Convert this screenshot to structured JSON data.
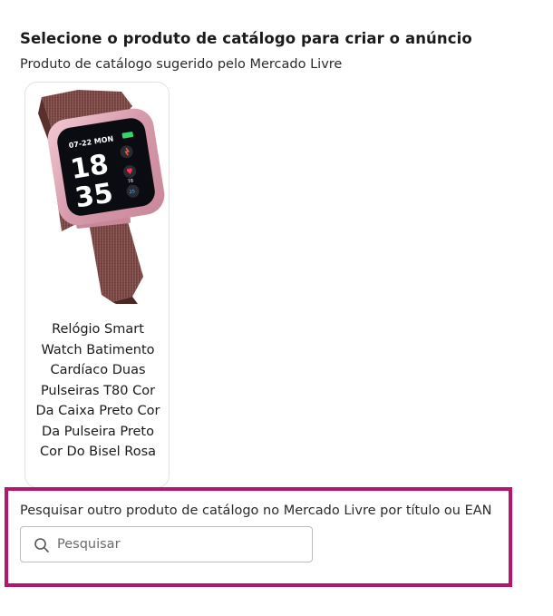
{
  "header": {
    "title": "Selecione o produto de catálogo para criar o anúncio",
    "subtitle": "Produto de catálogo sugerido pelo Mercado Livre"
  },
  "suggested_product": {
    "title": "Relógio Smart Watch Batimento Cardíaco Duas Pulseiras T80 Cor Da Caixa Preto Cor Da Pulseira Preto Cor Do Bisel Rosa",
    "image": {
      "date": "07-22 MON",
      "hour": "18",
      "minute": "35",
      "stats": [
        "78",
        "25"
      ]
    }
  },
  "search": {
    "label": "Pesquisar outro produto de catálogo no Mercado Livre por título ou EAN",
    "placeholder": "Pesquisar",
    "value": "",
    "icon": "search-icon",
    "highlight_color": "#b3166a"
  }
}
